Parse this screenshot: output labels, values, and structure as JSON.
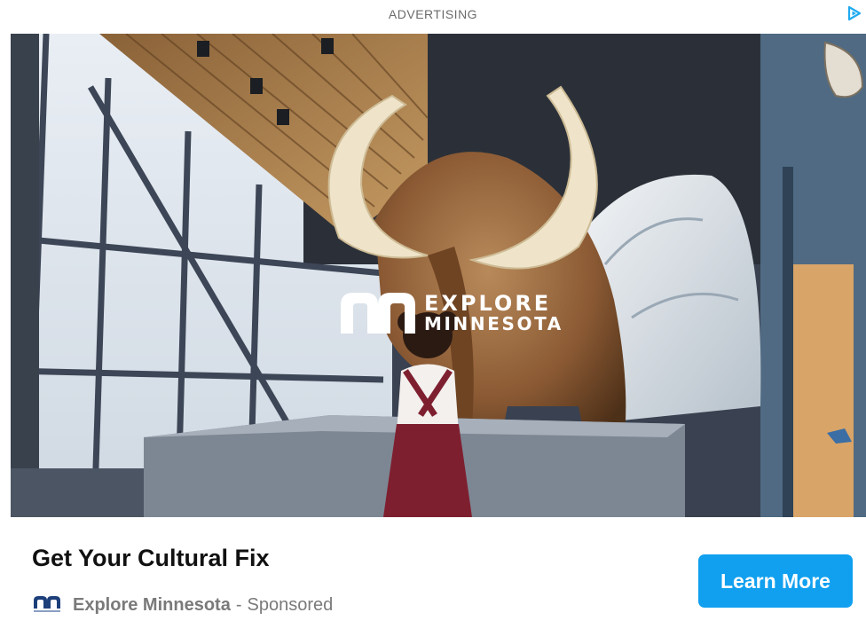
{
  "ad": {
    "label": "ADVERTISING",
    "headline": "Get Your Cultural Fix",
    "advertiser": "Explore Minnesota",
    "separator": "-",
    "sponsored": "Sponsored",
    "cta_label": "Learn More",
    "logo_line1": "EXPLORE",
    "logo_line2": "MINNESOTA"
  },
  "icons": {
    "adchoices": "adchoices-triangle-icon",
    "brand": "explore-minnesota-mn-icon"
  },
  "colors": {
    "cta_bg": "#10a0ef",
    "adchoices": "#20aaf0",
    "headline": "#111111",
    "meta_text": "#7a7a7a"
  }
}
